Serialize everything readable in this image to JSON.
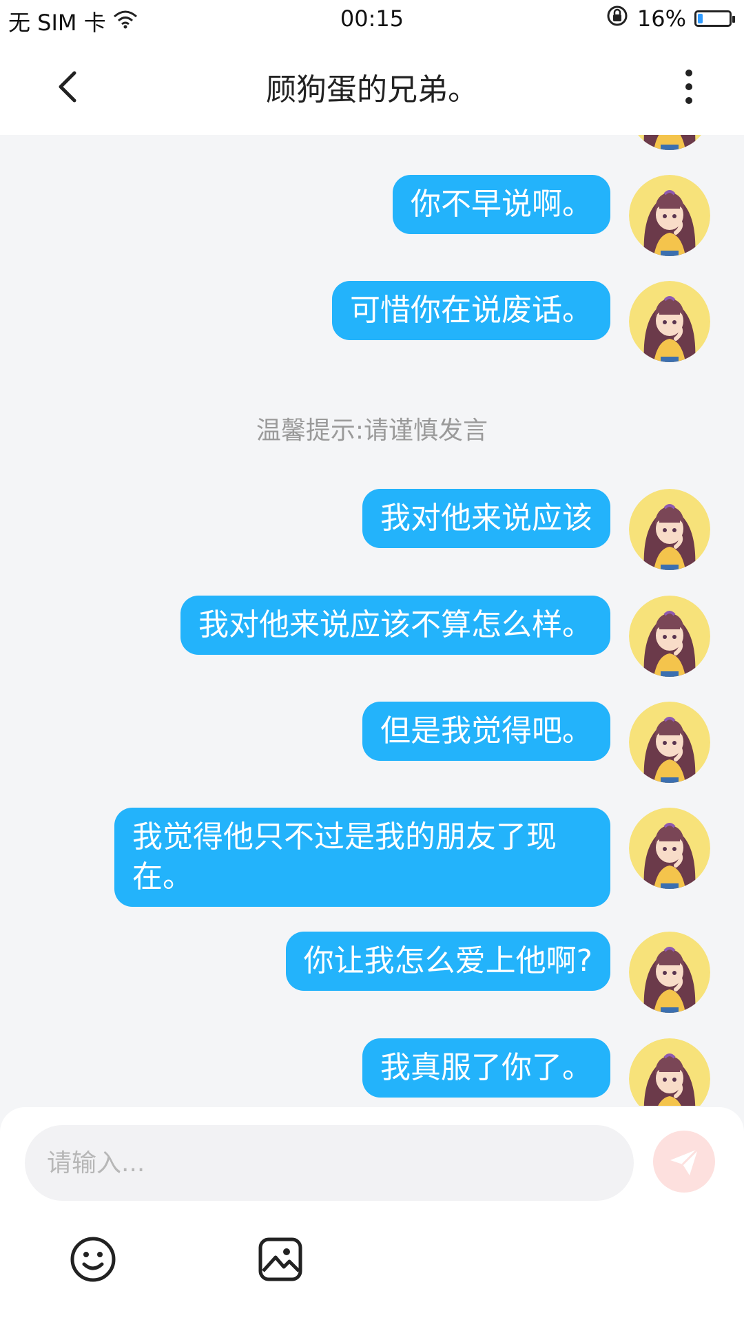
{
  "status_bar": {
    "carrier": "无 SIM 卡",
    "time": "00:15",
    "battery_percent_text": "16%",
    "battery_level": 0.16,
    "icons": [
      "wifi-icon",
      "rotation-lock-icon",
      "battery-icon"
    ]
  },
  "header": {
    "title": "顾狗蛋的兄弟。",
    "back_icon": "chevron-left-icon",
    "more_icon": "more-vertical-icon"
  },
  "messages": [
    {
      "text": "你不早说啊。"
    },
    {
      "text": "可惜你在说废话。"
    },
    {
      "text": "我对他来说应该"
    },
    {
      "text": "我对他来说应该不算怎么样。"
    },
    {
      "text": "但是我觉得吧。"
    },
    {
      "text": "我觉得他只不过是我的朋友了现在。"
    },
    {
      "text": "你让我怎么爱上他啊?"
    },
    {
      "text": "我真服了你了。"
    }
  ],
  "notice": "温馨提示:请谨慎发言",
  "input": {
    "placeholder": "请输入...",
    "value": ""
  },
  "colors": {
    "bubble": "#23b3fb",
    "bubble_text": "#ffffff",
    "background": "#f4f5f7",
    "send_button": "#fde0de"
  },
  "toolbar_icons": [
    "emoji-icon",
    "image-icon",
    "send-icon"
  ]
}
